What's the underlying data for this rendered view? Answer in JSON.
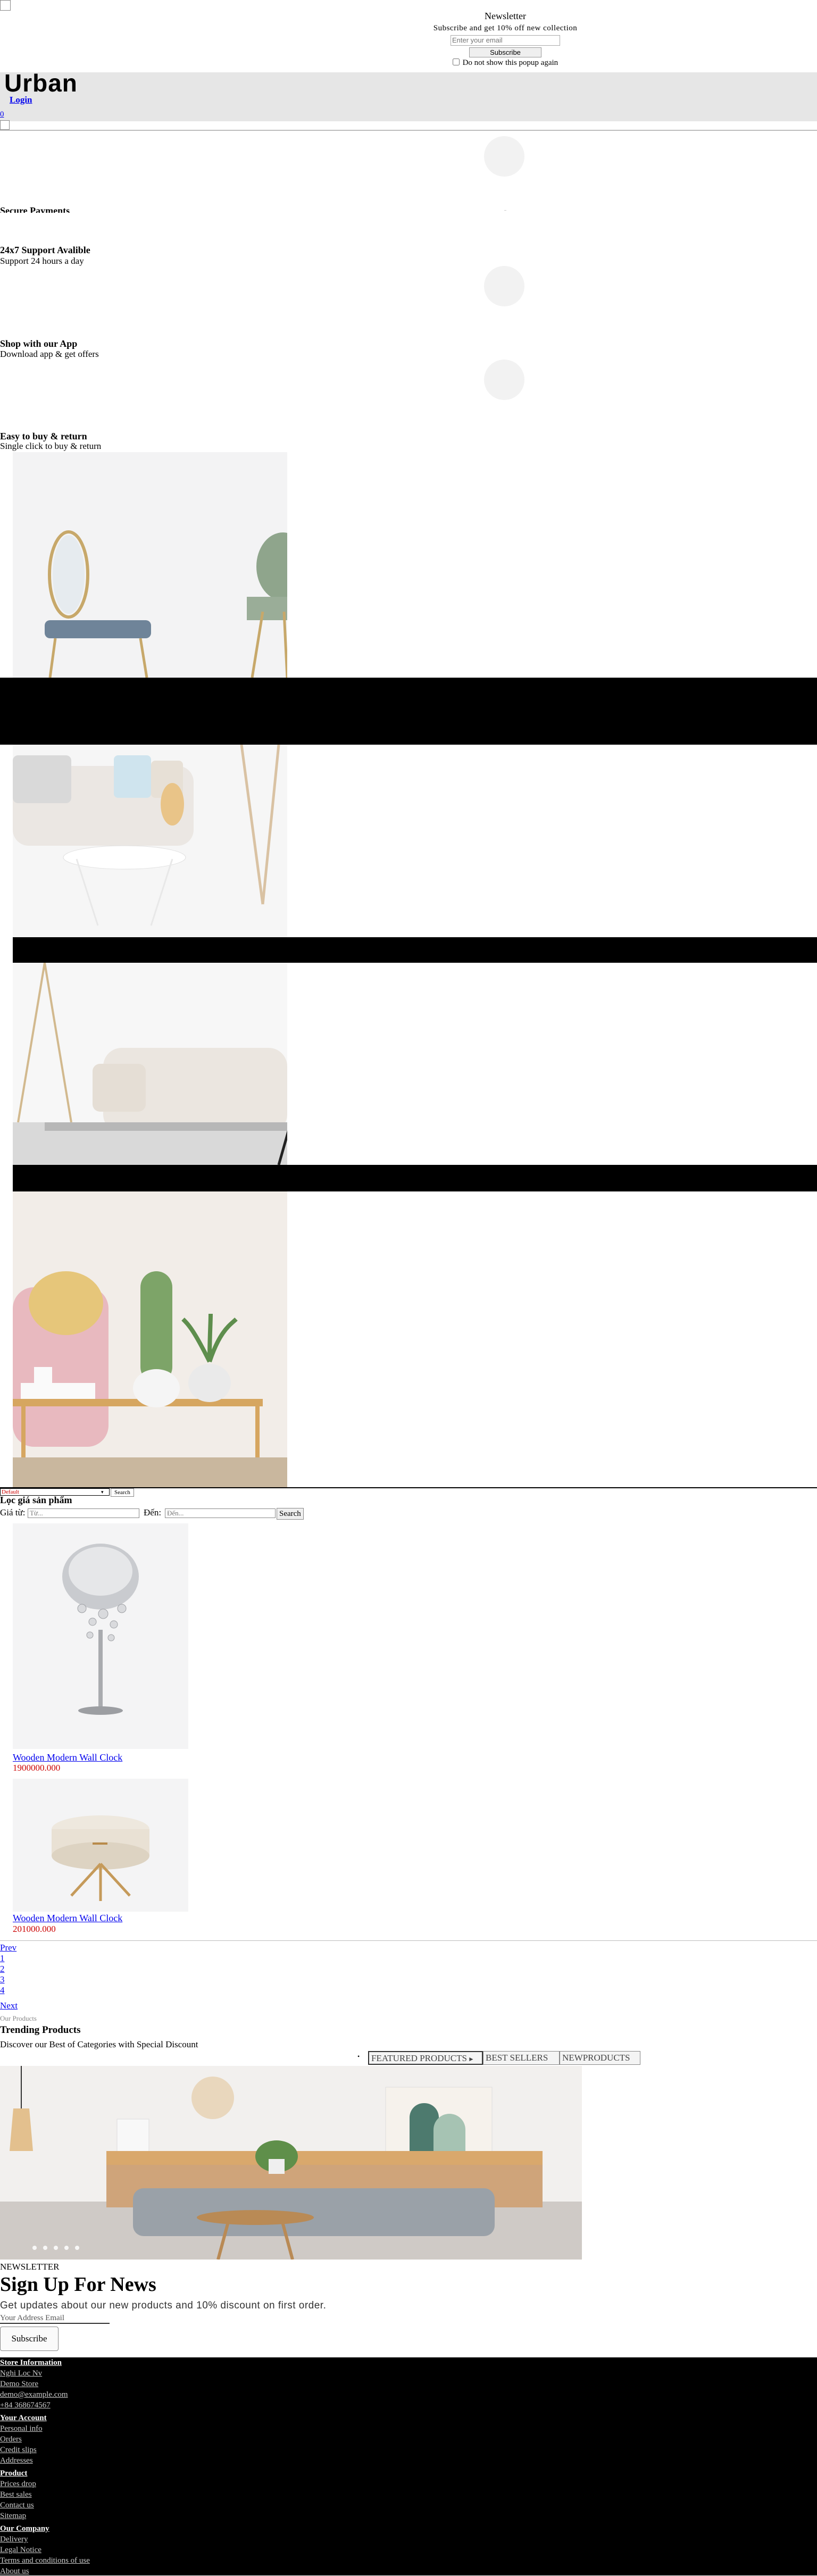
{
  "popup": {
    "title": "Newsletter",
    "subtitle": "Subscribe and get 10% off new collection",
    "email_placeholder": "Enter your email",
    "subscribe_label": "Subscribe",
    "dont_show_label": "Do not show this popup again"
  },
  "header": {
    "logo": "Urban",
    "login_label": "Login",
    "cart_count": "0"
  },
  "features": [
    {
      "title": "Secure Payments",
      "subtitle": ""
    },
    {
      "title": "24x7 Support Avalible",
      "subtitle": "Support 24 hours a day"
    },
    {
      "title": "Shop with our App",
      "subtitle": "Download app & get offers"
    },
    {
      "title": "Easy to buy & return",
      "subtitle": "Single click to buy & return"
    }
  ],
  "search": {
    "dropdown_value": "Default",
    "button_label": "Search"
  },
  "filter": {
    "title": "Lọc giá sản phẩm",
    "from_label": "Giá từ:",
    "from_placeholder": "Từ...",
    "to_label": "Đến:",
    "to_placeholder": "Đến...",
    "button_label": "Search"
  },
  "products": [
    {
      "name": "Wooden Modern Wall Clock",
      "price": "1900000.000"
    },
    {
      "name": "Wooden Modern Wall Clock",
      "price": "201000.000"
    }
  ],
  "pagination": {
    "prev_label": "Prev",
    "pages": [
      "1",
      "2",
      "3",
      "4"
    ],
    "next_label": "Next"
  },
  "trending": {
    "kicker": "Our Products",
    "title": "Trending Products",
    "subtitle": "Discover our Best of Categories with Special Discount",
    "tabs": [
      "FEATURED PRODUCTS",
      "BEST SELLERS",
      "NEWPRODUCTS"
    ]
  },
  "newsletter": {
    "kicker": "NEWSLETTER",
    "title": "Sign Up For News",
    "text": "Get updates about our new products and 10% discount on first order.",
    "email_placeholder": "Your Address Email",
    "button_label": "Subscribe"
  },
  "footer": {
    "store_info": {
      "heading": "Store Information",
      "lines": [
        "Nghi Loc Nv",
        "Demo Store",
        "demo@example.com",
        "+84 368674567"
      ]
    },
    "account": {
      "heading": "Your Account",
      "links": [
        "Personal info",
        "Orders",
        "Credit slips",
        "Addresses"
      ]
    },
    "product": {
      "heading": "Product",
      "links": [
        "Prices drop",
        "Best sales",
        "Contact us",
        "Sitemap"
      ]
    },
    "company": {
      "heading": "Our Company",
      "links": [
        "Delivery",
        "Legal Notice",
        "Terms and conditions of use",
        "About us"
      ]
    }
  }
}
